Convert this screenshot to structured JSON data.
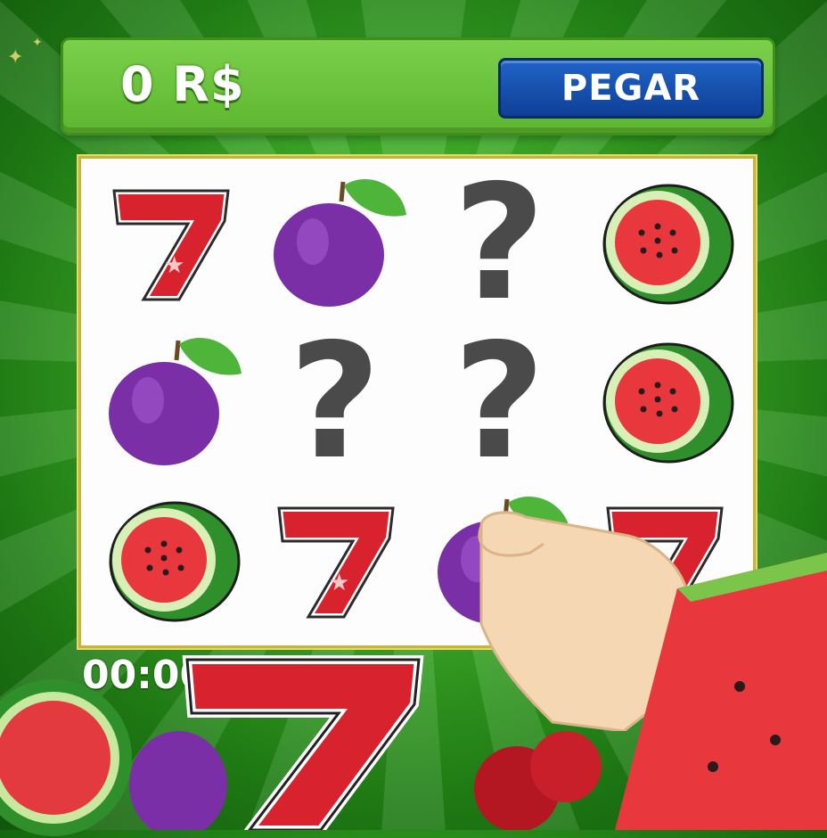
{
  "header": {
    "balance": "0 R$",
    "collect_label": "PEGAR"
  },
  "board": {
    "rows": [
      [
        "seven",
        "plum",
        "hidden",
        "watermelon"
      ],
      [
        "plum",
        "hidden",
        "hidden",
        "watermelon"
      ],
      [
        "watermelon",
        "seven",
        "plum",
        "seven"
      ]
    ],
    "hidden_symbol": "?"
  },
  "timer": "00:00",
  "colors": {
    "background": "#3fae28",
    "button": "#1f64c7",
    "seven": "#d8232f",
    "plum": "#7b2fa6",
    "watermelon": "#e8383d"
  }
}
